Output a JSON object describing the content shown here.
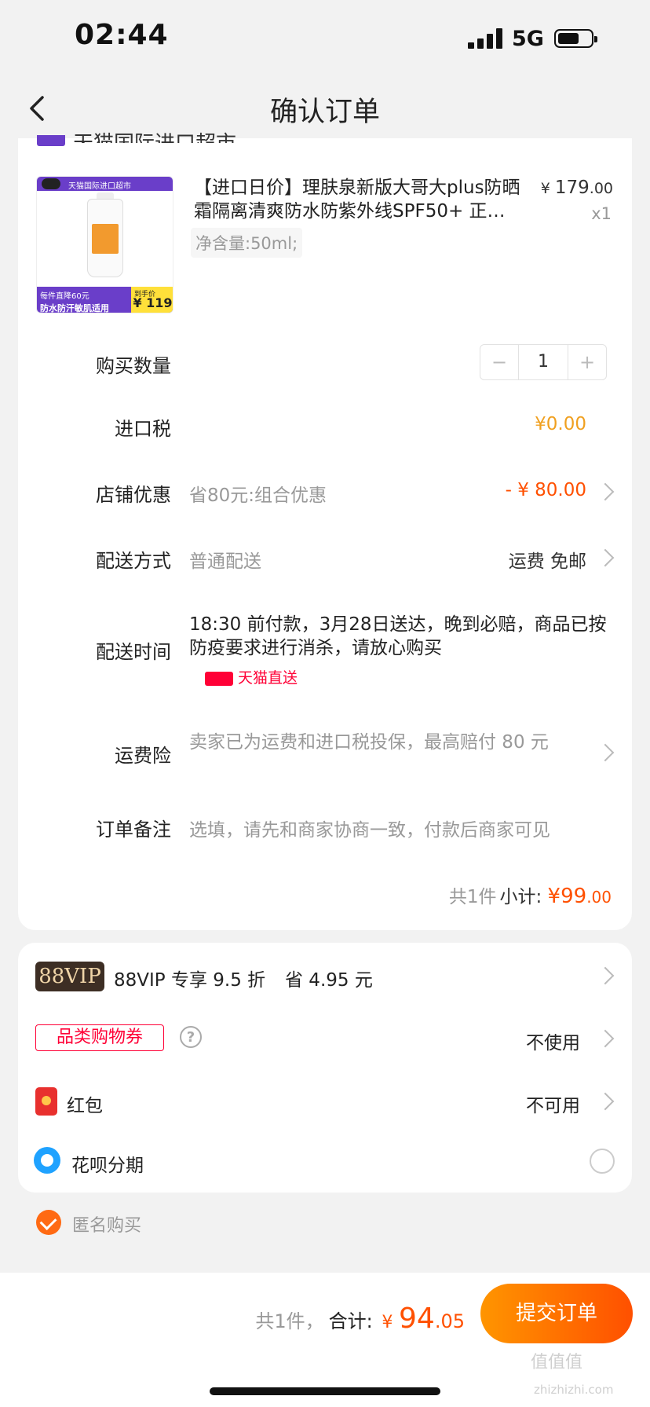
{
  "status_bar": {
    "time": "02:44",
    "network": "5G"
  },
  "nav": {
    "title": "确认订单"
  },
  "shop": {
    "name": "天猫国际进口超市"
  },
  "product": {
    "image_banner": "天猫国际进口超市",
    "image_sale": "每件直降60元",
    "image_adv": "防水防汗敏肌适用",
    "image_price_label": "到手价",
    "image_price": "¥ 119",
    "title": "【进口日价】理肤泉新版大哥大plus防晒霜隔离清爽防水防紫外线SPF50+ 正…",
    "spec": "净含量:50ml;",
    "price_currency": "¥",
    "price_int": "179",
    "price_dec": ".00",
    "quantity": "x1"
  },
  "rows": {
    "quantity": {
      "label": "购买数量",
      "value": "1",
      "minus": "−",
      "plus": "+"
    },
    "import_tax": {
      "label": "进口税",
      "value": "¥0.00"
    },
    "shop_discount": {
      "label": "店铺优惠",
      "desc": "省80元:组合优惠",
      "value": "- ¥ 80.00"
    },
    "shipping": {
      "label": "配送方式",
      "desc": "普通配送",
      "value": "运费 免邮"
    },
    "delivery_time": {
      "label": "配送时间",
      "desc": "18:30 前付款，3月28日送达，晚到必赔，商品已按防疫要求进行消杀，请放心购买",
      "badge": "天猫直送"
    },
    "freight_insurance": {
      "label": "运费险",
      "desc": "卖家已为运费和进口税投保，最高赔付 80 元"
    },
    "order_note": {
      "label": "订单备注",
      "placeholder": "选填，请先和商家协商一致，付款后商家可见"
    }
  },
  "subtotal": {
    "count": "共1件",
    "label": "小计:",
    "currency": "¥",
    "amount": "99",
    "decimal": ".00"
  },
  "promos": {
    "vip": {
      "badge": "88VIP",
      "text": "88VIP 专享 9.5 折",
      "save": "省 4.95 元"
    },
    "coupon": {
      "badge": "品类购物券",
      "help": "?",
      "value": "不使用"
    },
    "hongbao": {
      "label": "红包",
      "value": "不可用"
    },
    "huabei": {
      "label": "花呗分期"
    }
  },
  "anonymous": {
    "label": "匿名购买",
    "checked": true
  },
  "footer": {
    "count": "共1件，",
    "label": "合计:",
    "currency": "¥",
    "amount": "94",
    "decimal": ".05",
    "submit": "提交订单"
  },
  "watermark": {
    "text": "值值值",
    "sub": "zhizhizhi.com"
  },
  "colors": {
    "accent": "#ff5000",
    "tax": "#f0a020",
    "tmall": "#ff0036",
    "vip_bg": "#3d2e24"
  }
}
